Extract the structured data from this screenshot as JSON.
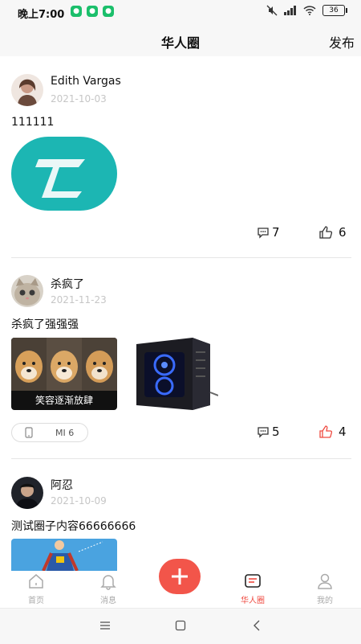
{
  "status_bar": {
    "time": "晚上7:00",
    "battery": "36"
  },
  "header": {
    "title": "华人圈",
    "publish_label": "发布"
  },
  "posts": [
    {
      "user": "Edith Vargas",
      "date": "2021-10-03",
      "text": "111111",
      "comments": "7",
      "likes": "6",
      "liked": false
    },
    {
      "user": "杀疯了",
      "date": "2021-11-23",
      "text": "杀疯了强强强",
      "image_caption": "笑容逐渐放肆",
      "device": "MI 6",
      "comments": "5",
      "likes": "4",
      "liked": true
    },
    {
      "user": "阿忍",
      "date": "2021-10-09",
      "text": "测试圈子内容66666666"
    }
  ],
  "tabs": [
    {
      "label": "首页",
      "icon": "home-icon"
    },
    {
      "label": "消息",
      "icon": "bell-icon"
    },
    {
      "label": "华人圈",
      "icon": "message-square-icon",
      "active": true
    },
    {
      "label": "我的",
      "icon": "user-icon"
    }
  ],
  "colors": {
    "accent": "#ef4a40",
    "fab": "#f2554a",
    "logo_teal": "#1cb6b3"
  }
}
